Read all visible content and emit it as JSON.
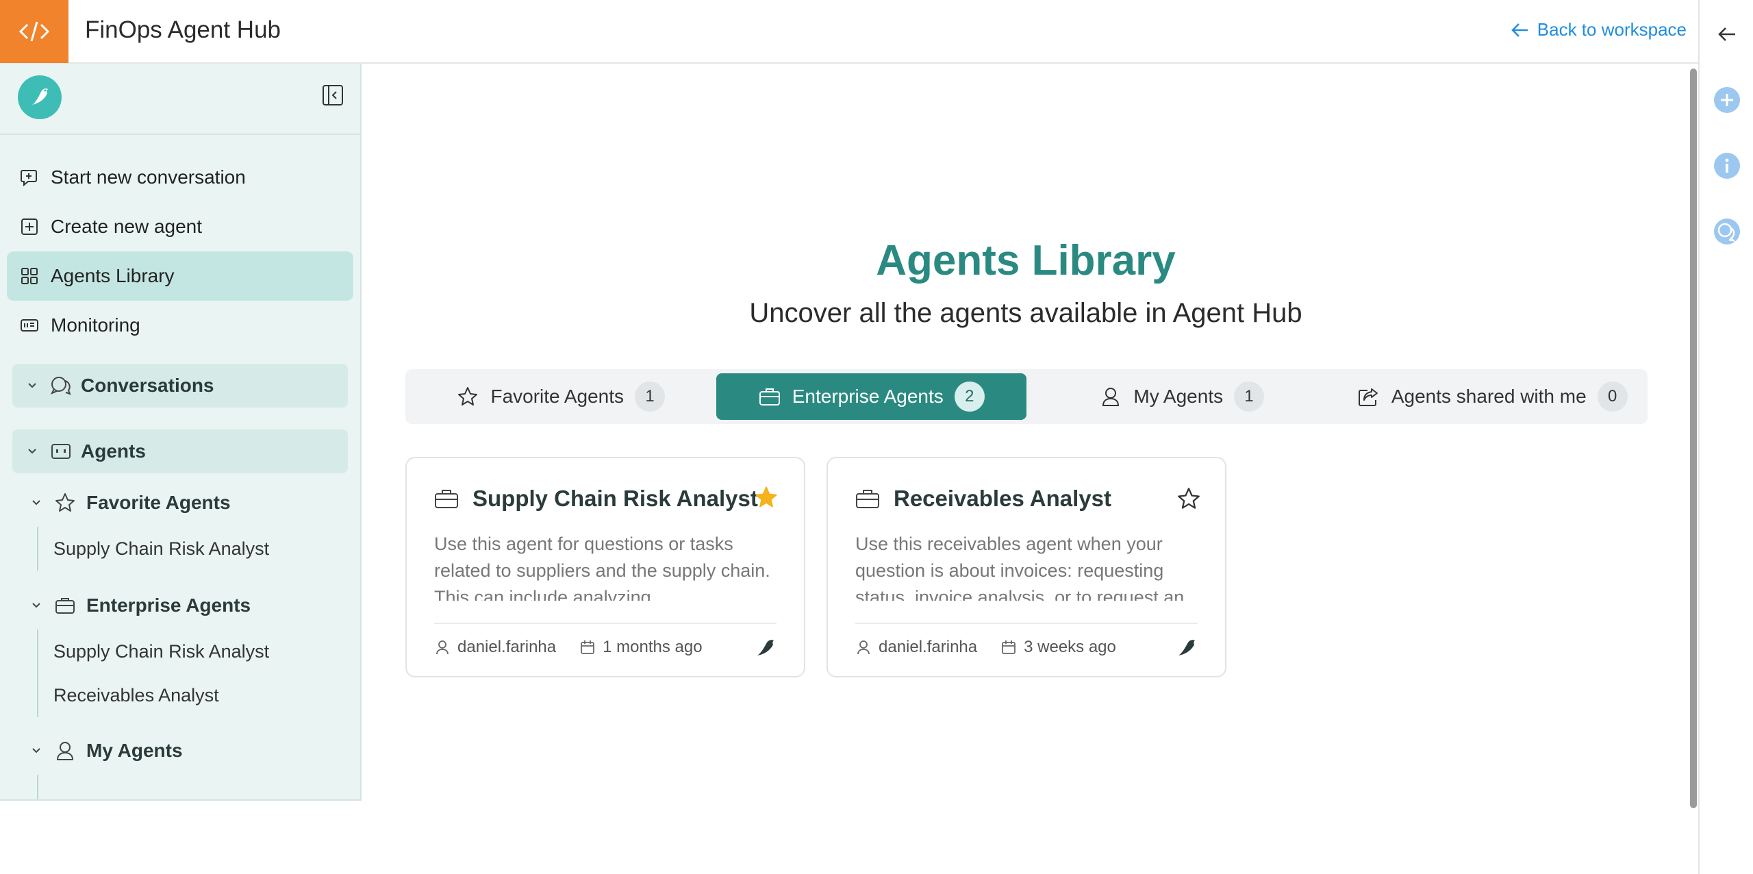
{
  "app": {
    "title": "FinOps Agent Hub",
    "back_link": "Back to workspace",
    "accent": "#2a8a82",
    "brand": "#f0832b"
  },
  "sidebar": {
    "nav": [
      {
        "label": "Start new conversation",
        "icon": "chat-plus-icon"
      },
      {
        "label": "Create new agent",
        "icon": "add-square-icon"
      },
      {
        "label": "Agents Library",
        "icon": "grid-icon",
        "active": true
      },
      {
        "label": "Monitoring",
        "icon": "monitor-icon"
      }
    ],
    "conversations_label": "Conversations",
    "agents_label": "Agents",
    "favorite_label": "Favorite Agents",
    "favorite_items": [
      "Supply Chain Risk Analyst"
    ],
    "enterprise_label": "Enterprise Agents",
    "enterprise_items": [
      "Supply Chain Risk Analyst",
      "Receivables Analyst"
    ],
    "my_agents_label": "My Agents"
  },
  "main": {
    "title": "Agents Library",
    "subtitle": "Uncover all the agents available in Agent Hub",
    "tabs": [
      {
        "label": "Favorite Agents",
        "count": "1"
      },
      {
        "label": "Enterprise Agents",
        "count": "2",
        "active": true
      },
      {
        "label": "My Agents",
        "count": "1"
      },
      {
        "label": "Agents shared with me",
        "count": "0"
      }
    ],
    "cards": [
      {
        "title": "Supply Chain Risk Analyst",
        "description": "Use this agent for questions or tasks related to suppliers and the supply chain. This can include analyzing",
        "author": "daniel.farinha",
        "date": "1 months ago",
        "favorite": true
      },
      {
        "title": "Receivables Analyst",
        "description": "Use this receivables agent when your question is about invoices: requesting status, invoice analysis, or to request an",
        "author": "daniel.farinha",
        "date": "3 weeks ago",
        "favorite": false
      }
    ]
  }
}
